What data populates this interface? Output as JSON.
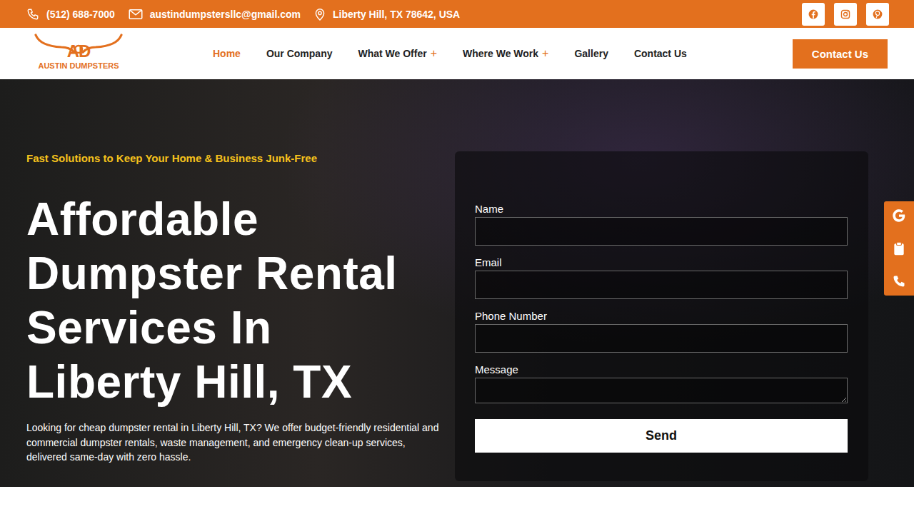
{
  "topbar": {
    "phone": "(512) 688-7000",
    "email": "austindumpstersllc@gmail.com",
    "address": "Liberty Hill, TX 78642, USA"
  },
  "logo": {
    "monogram": "AD",
    "name": "AUSTIN DUMPSTERS"
  },
  "nav": [
    {
      "label": "Home",
      "selected": true,
      "has_submenu": false
    },
    {
      "label": "Our Company",
      "selected": false,
      "has_submenu": false
    },
    {
      "label": "What We Offer",
      "selected": false,
      "has_submenu": true
    },
    {
      "label": "Where We Work",
      "selected": false,
      "has_submenu": true
    },
    {
      "label": "Gallery",
      "selected": false,
      "has_submenu": false
    },
    {
      "label": "Contact Us",
      "selected": false,
      "has_submenu": false
    }
  ],
  "submenu_marker": "+",
  "cta": "Contact Us",
  "hero": {
    "tagline": "Fast Solutions to Keep Your Home & Business Junk-Free",
    "heading_lines": [
      "Affordable",
      "Dumpster Rental",
      "Services In",
      "Liberty Hill, TX"
    ],
    "text": "Looking for cheap dumpster rental in Liberty Hill, TX? We offer budget-friendly residential and commercial dumpster rentals, waste management, and emergency clean-up services, delivered same-day with zero hassle."
  },
  "form": {
    "fields": [
      {
        "label": "Name",
        "kind": "input"
      },
      {
        "label": "Email",
        "kind": "input"
      },
      {
        "label": "Phone Number",
        "kind": "input"
      },
      {
        "label": "Message",
        "kind": "textarea"
      }
    ],
    "submit": "Send"
  }
}
